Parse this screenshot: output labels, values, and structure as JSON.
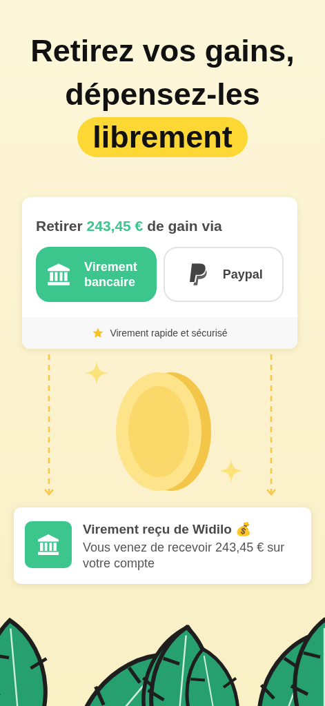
{
  "headline": {
    "lines": [
      "Retirez vos gains,",
      "dépensez-les"
    ],
    "highlight": "librement"
  },
  "withdraw_card": {
    "title_prefix": "Retirer",
    "amount": "243,45 €",
    "title_suffix": "de gain via",
    "methods": [
      {
        "kind": "bank",
        "label": "Virement bancaire",
        "selected": true
      },
      {
        "kind": "paypal",
        "label": "Paypal",
        "selected": false
      }
    ],
    "note": "Virement rapide et sécurisé"
  },
  "notification": {
    "title": "Virement reçu de Widilo 💰",
    "body": "Vous venez de recevoir 243,45 € sur votre compte"
  }
}
